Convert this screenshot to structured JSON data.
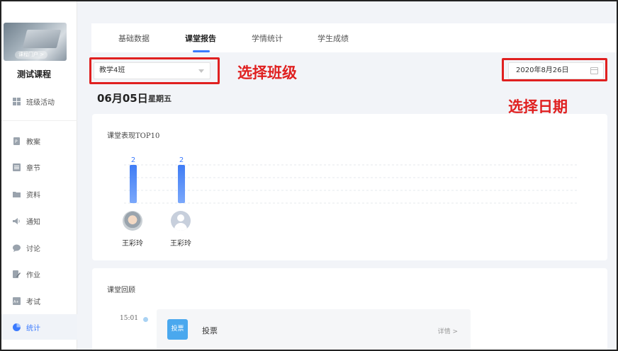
{
  "sidebar": {
    "course_portal": "课程门户 >",
    "course_name": "测试课程",
    "items": [
      {
        "label": "班级活动",
        "icon": "grid-icon"
      },
      {
        "label": "教案",
        "icon": "document-icon"
      },
      {
        "label": "章节",
        "icon": "list-icon"
      },
      {
        "label": "资料",
        "icon": "folder-icon"
      },
      {
        "label": "通知",
        "icon": "speaker-icon"
      },
      {
        "label": "讨论",
        "icon": "chat-bubble-icon"
      },
      {
        "label": "作业",
        "icon": "edit-icon"
      },
      {
        "label": "考试",
        "icon": "exam-icon"
      },
      {
        "label": "统计",
        "icon": "pie-chart-icon"
      }
    ],
    "active_item": "统计"
  },
  "tabs": [
    {
      "label": "基础数据"
    },
    {
      "label": "课堂报告",
      "active": true
    },
    {
      "label": "学情统计"
    },
    {
      "label": "学生成绩"
    }
  ],
  "filters": {
    "class_select": "教学4班",
    "date": "2020年8月26日"
  },
  "annotations": {
    "select_class": "选择班级",
    "select_date": "选择日期"
  },
  "report": {
    "date": "06月05日",
    "weekday": "星期五"
  },
  "top10": {
    "title": "课堂表现TOP10",
    "students": [
      {
        "name": "王彩玲",
        "value_label": "2",
        "avatar": "photo"
      },
      {
        "name": "王彩玲",
        "value_label": "2",
        "avatar": "default"
      }
    ]
  },
  "chart_data": {
    "type": "bar",
    "title": "课堂表现TOP10",
    "categories": [
      "王彩玲",
      "王彩玲"
    ],
    "values": [
      2,
      2
    ],
    "ylim": [
      0,
      2
    ],
    "grid": true,
    "bar_color": "#5b8ff9"
  },
  "review": {
    "title": "课堂回顾",
    "items": [
      {
        "time": "15:01",
        "badge": "投票",
        "label": "投票",
        "detail": "详情 >"
      }
    ]
  },
  "colors": {
    "accent": "#3a7afe",
    "annotation_red": "#e02020",
    "badge_blue": "#4aa8ee"
  }
}
